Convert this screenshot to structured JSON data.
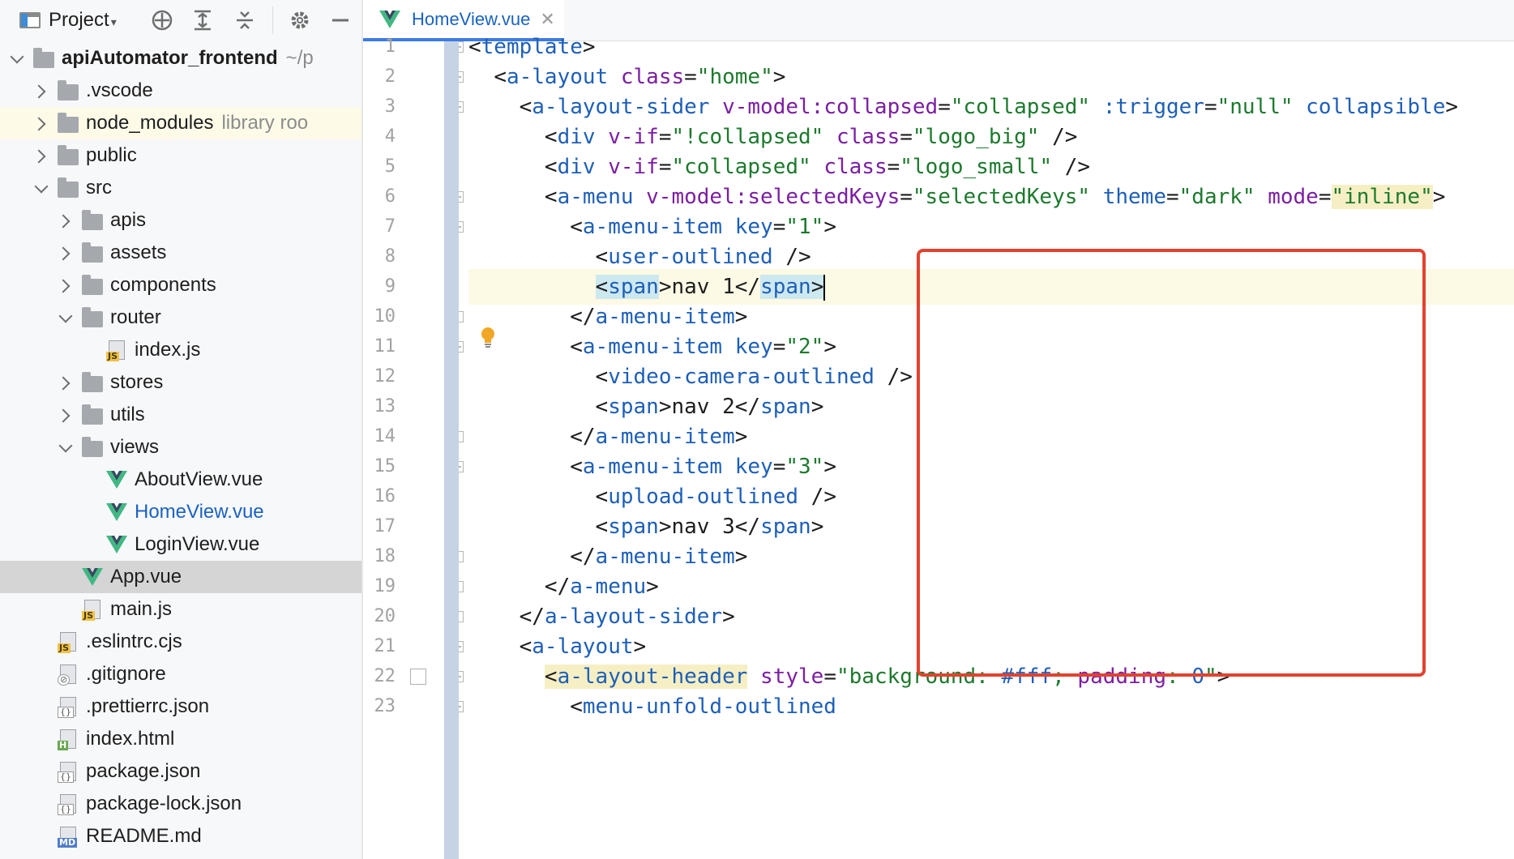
{
  "project_panel": {
    "title": "Project",
    "dropdown_glyph": "▾",
    "toolbar_icons": [
      "locate-icon",
      "expand-all-icon",
      "collapse-all-icon",
      "gear-icon",
      "hide-icon"
    ],
    "tree": [
      {
        "label": "apiAutomator_frontend",
        "hint": "~/p",
        "indent": 0,
        "expand": "down",
        "icon": "folder",
        "bold": true
      },
      {
        "label": ".vscode",
        "indent": 1,
        "expand": "right",
        "icon": "folder"
      },
      {
        "label": "node_modules",
        "hint": "library roo",
        "indent": 1,
        "expand": "right",
        "icon": "folder",
        "highlight": "yellow"
      },
      {
        "label": "public",
        "indent": 1,
        "expand": "right",
        "icon": "folder"
      },
      {
        "label": "src",
        "indent": 1,
        "expand": "down",
        "icon": "folder"
      },
      {
        "label": "apis",
        "indent": 2,
        "expand": "right",
        "icon": "folder"
      },
      {
        "label": "assets",
        "indent": 2,
        "expand": "right",
        "icon": "folder"
      },
      {
        "label": "components",
        "indent": 2,
        "expand": "right",
        "icon": "folder"
      },
      {
        "label": "router",
        "indent": 2,
        "expand": "down",
        "icon": "folder"
      },
      {
        "label": "index.js",
        "indent": 3,
        "expand": "none",
        "icon": "js"
      },
      {
        "label": "stores",
        "indent": 2,
        "expand": "right",
        "icon": "folder"
      },
      {
        "label": "utils",
        "indent": 2,
        "expand": "right",
        "icon": "folder"
      },
      {
        "label": "views",
        "indent": 2,
        "expand": "down",
        "icon": "folder"
      },
      {
        "label": "AboutView.vue",
        "indent": 3,
        "expand": "none",
        "icon": "vue"
      },
      {
        "label": "HomeView.vue",
        "indent": 3,
        "expand": "none",
        "icon": "vue",
        "link": true
      },
      {
        "label": "LoginView.vue",
        "indent": 3,
        "expand": "none",
        "icon": "vue"
      },
      {
        "label": "App.vue",
        "indent": 2,
        "expand": "none",
        "icon": "vue",
        "highlight": "selected"
      },
      {
        "label": "main.js",
        "indent": 2,
        "expand": "none",
        "icon": "js"
      },
      {
        "label": ".eslintrc.cjs",
        "indent": 1,
        "expand": "none",
        "icon": "js"
      },
      {
        "label": ".gitignore",
        "indent": 1,
        "expand": "none",
        "icon": "gitignore"
      },
      {
        "label": ".prettierrc.json",
        "indent": 1,
        "expand": "none",
        "icon": "json"
      },
      {
        "label": "index.html",
        "indent": 1,
        "expand": "none",
        "icon": "html"
      },
      {
        "label": "package.json",
        "indent": 1,
        "expand": "none",
        "icon": "json"
      },
      {
        "label": "package-lock.json",
        "indent": 1,
        "expand": "none",
        "icon": "json"
      },
      {
        "label": "README.md",
        "indent": 1,
        "expand": "none",
        "icon": "md"
      }
    ]
  },
  "editor": {
    "tab": {
      "label": "HomeView.vue",
      "close": "✕"
    },
    "current_line": 9,
    "lines": [
      {
        "n": "1",
        "fold": "open",
        "tokens": [
          [
            "pn",
            "<"
          ],
          [
            "tg",
            "template"
          ],
          [
            "pn",
            ">"
          ]
        ]
      },
      {
        "n": "2",
        "fold": "open",
        "tokens": [
          [
            "tx",
            "  "
          ],
          [
            "pn",
            "<"
          ],
          [
            "tg",
            "a-layout "
          ],
          [
            "at",
            "class"
          ],
          [
            "pn",
            "="
          ],
          [
            "st",
            "\"home\""
          ],
          [
            "pn",
            ">"
          ]
        ]
      },
      {
        "n": "3",
        "fold": "open",
        "tokens": [
          [
            "tx",
            "    "
          ],
          [
            "pn",
            "<"
          ],
          [
            "tg",
            "a-layout-sider "
          ],
          [
            "at",
            "v-model:collapsed"
          ],
          [
            "pn",
            "="
          ],
          [
            "st",
            "\"collapsed\""
          ],
          [
            "tx",
            " "
          ],
          [
            "tg",
            ":trigger"
          ],
          [
            "pn",
            "="
          ],
          [
            "st",
            "\"null\""
          ],
          [
            "tx",
            " "
          ],
          [
            "tg",
            "collapsible"
          ],
          [
            "pn",
            ">"
          ]
        ]
      },
      {
        "n": "4",
        "tokens": [
          [
            "tx",
            "      "
          ],
          [
            "pn",
            "<"
          ],
          [
            "tg",
            "div "
          ],
          [
            "at",
            "v-if"
          ],
          [
            "pn",
            "="
          ],
          [
            "st",
            "\"!collapsed\""
          ],
          [
            "tx",
            " "
          ],
          [
            "at",
            "class"
          ],
          [
            "pn",
            "="
          ],
          [
            "st",
            "\"logo_big\""
          ],
          [
            "pn",
            " />"
          ]
        ]
      },
      {
        "n": "5",
        "tokens": [
          [
            "tx",
            "      "
          ],
          [
            "pn",
            "<"
          ],
          [
            "tg",
            "div "
          ],
          [
            "at",
            "v-if"
          ],
          [
            "pn",
            "="
          ],
          [
            "st",
            "\"collapsed\""
          ],
          [
            "tx",
            " "
          ],
          [
            "at",
            "class"
          ],
          [
            "pn",
            "="
          ],
          [
            "st",
            "\"logo_small\""
          ],
          [
            "pn",
            " />"
          ]
        ]
      },
      {
        "n": "6",
        "fold": "open",
        "tokens": [
          [
            "tx",
            "      "
          ],
          [
            "pn",
            "<"
          ],
          [
            "tg",
            "a-menu "
          ],
          [
            "at",
            "v-model:selectedKeys"
          ],
          [
            "pn",
            "="
          ],
          [
            "st",
            "\"selectedKeys\""
          ],
          [
            "tx",
            " "
          ],
          [
            "tg",
            "theme"
          ],
          [
            "pn",
            "="
          ],
          [
            "st",
            "\"dark\""
          ],
          [
            "tx",
            " "
          ],
          [
            "at",
            "mode"
          ],
          [
            "pn",
            "="
          ],
          [
            "st hl-yel",
            "\"inline\""
          ],
          [
            "pn",
            ">"
          ]
        ]
      },
      {
        "n": "7",
        "fold": "open",
        "tokens": [
          [
            "tx",
            "        "
          ],
          [
            "pn",
            "<"
          ],
          [
            "tg",
            "a-menu-item "
          ],
          [
            "tg",
            "key"
          ],
          [
            "pn",
            "="
          ],
          [
            "st",
            "\"1\""
          ],
          [
            "pn",
            ">"
          ]
        ]
      },
      {
        "n": "8",
        "tokens": [
          [
            "tx",
            "          "
          ],
          [
            "pn",
            "<"
          ],
          [
            "tg",
            "user-outlined"
          ],
          [
            "pn",
            " />"
          ]
        ]
      },
      {
        "n": "9",
        "tokens": [
          [
            "tx",
            "          "
          ],
          [
            "pn hl-tag",
            "<"
          ],
          [
            "tg hl-tag",
            "span"
          ],
          [
            "pn",
            ">"
          ],
          [
            "tx",
            "nav 1"
          ],
          [
            "pn",
            "</"
          ],
          [
            "tg hl-tag",
            "span"
          ],
          [
            "pn hl-tag",
            ">"
          ]
        ]
      },
      {
        "n": "10",
        "fold": "close",
        "tokens": [
          [
            "tx",
            "        "
          ],
          [
            "pn",
            "</"
          ],
          [
            "tg",
            "a-menu-item"
          ],
          [
            "pn",
            ">"
          ]
        ]
      },
      {
        "n": "11",
        "fold": "open",
        "tokens": [
          [
            "tx",
            "        "
          ],
          [
            "pn",
            "<"
          ],
          [
            "tg",
            "a-menu-item "
          ],
          [
            "tg",
            "key"
          ],
          [
            "pn",
            "="
          ],
          [
            "st",
            "\"2\""
          ],
          [
            "pn",
            ">"
          ]
        ]
      },
      {
        "n": "12",
        "tokens": [
          [
            "tx",
            "          "
          ],
          [
            "pn",
            "<"
          ],
          [
            "tg",
            "video-camera-outlined"
          ],
          [
            "pn",
            " />"
          ]
        ]
      },
      {
        "n": "13",
        "tokens": [
          [
            "tx",
            "          "
          ],
          [
            "pn",
            "<"
          ],
          [
            "tg",
            "span"
          ],
          [
            "pn",
            ">"
          ],
          [
            "tx",
            "nav 2"
          ],
          [
            "pn",
            "</"
          ],
          [
            "tg",
            "span"
          ],
          [
            "pn",
            ">"
          ]
        ]
      },
      {
        "n": "14",
        "fold": "close",
        "tokens": [
          [
            "tx",
            "        "
          ],
          [
            "pn",
            "</"
          ],
          [
            "tg",
            "a-menu-item"
          ],
          [
            "pn",
            ">"
          ]
        ]
      },
      {
        "n": "15",
        "fold": "open",
        "tokens": [
          [
            "tx",
            "        "
          ],
          [
            "pn",
            "<"
          ],
          [
            "tg",
            "a-menu-item "
          ],
          [
            "tg",
            "key"
          ],
          [
            "pn",
            "="
          ],
          [
            "st",
            "\"3\""
          ],
          [
            "pn",
            ">"
          ]
        ]
      },
      {
        "n": "16",
        "tokens": [
          [
            "tx",
            "          "
          ],
          [
            "pn",
            "<"
          ],
          [
            "tg",
            "upload-outlined"
          ],
          [
            "pn",
            " />"
          ]
        ]
      },
      {
        "n": "17",
        "tokens": [
          [
            "tx",
            "          "
          ],
          [
            "pn",
            "<"
          ],
          [
            "tg",
            "span"
          ],
          [
            "pn",
            ">"
          ],
          [
            "tx",
            "nav 3"
          ],
          [
            "pn",
            "</"
          ],
          [
            "tg",
            "span"
          ],
          [
            "pn",
            ">"
          ]
        ]
      },
      {
        "n": "18",
        "fold": "close",
        "tokens": [
          [
            "tx",
            "        "
          ],
          [
            "pn",
            "</"
          ],
          [
            "tg",
            "a-menu-item"
          ],
          [
            "pn",
            ">"
          ]
        ]
      },
      {
        "n": "19",
        "fold": "close",
        "tokens": [
          [
            "tx",
            "      "
          ],
          [
            "pn",
            "</"
          ],
          [
            "tg",
            "a-menu"
          ],
          [
            "pn",
            ">"
          ]
        ]
      },
      {
        "n": "20",
        "fold": "close",
        "tokens": [
          [
            "tx",
            "    "
          ],
          [
            "pn",
            "</"
          ],
          [
            "tg",
            "a-layout-sider"
          ],
          [
            "pn",
            ">"
          ]
        ]
      },
      {
        "n": "21",
        "fold": "open",
        "tokens": [
          [
            "tx",
            "    "
          ],
          [
            "pn",
            "<"
          ],
          [
            "tg",
            "a-layout"
          ],
          [
            "pn",
            ">"
          ]
        ]
      },
      {
        "n": "22",
        "fold": "open",
        "bookmark": true,
        "tokens": [
          [
            "tx",
            "      "
          ],
          [
            "pn hl-yel",
            "<"
          ],
          [
            "tg hl-yel",
            "a-layout-header"
          ],
          [
            "tx",
            " "
          ],
          [
            "at",
            "style"
          ],
          [
            "pn",
            "="
          ],
          [
            "st",
            "\"background: "
          ],
          [
            "tg",
            "#fff"
          ],
          [
            "st",
            "; "
          ],
          [
            "at",
            "padding"
          ],
          [
            "st",
            ": "
          ],
          [
            "tg",
            "0"
          ],
          [
            "st",
            "\""
          ],
          [
            "pn",
            ">"
          ]
        ]
      },
      {
        "n": "23",
        "fold": "open",
        "tokens": [
          [
            "tx",
            "        "
          ],
          [
            "pn",
            "<"
          ],
          [
            "tg",
            "menu-unfold-outlined"
          ]
        ]
      }
    ]
  },
  "colors": {
    "accent": "#3d7be0",
    "annotation": "#e2422f",
    "tag": "#1e5fb8",
    "attribute": "#7b1fa2",
    "string": "#1d7a2d"
  }
}
